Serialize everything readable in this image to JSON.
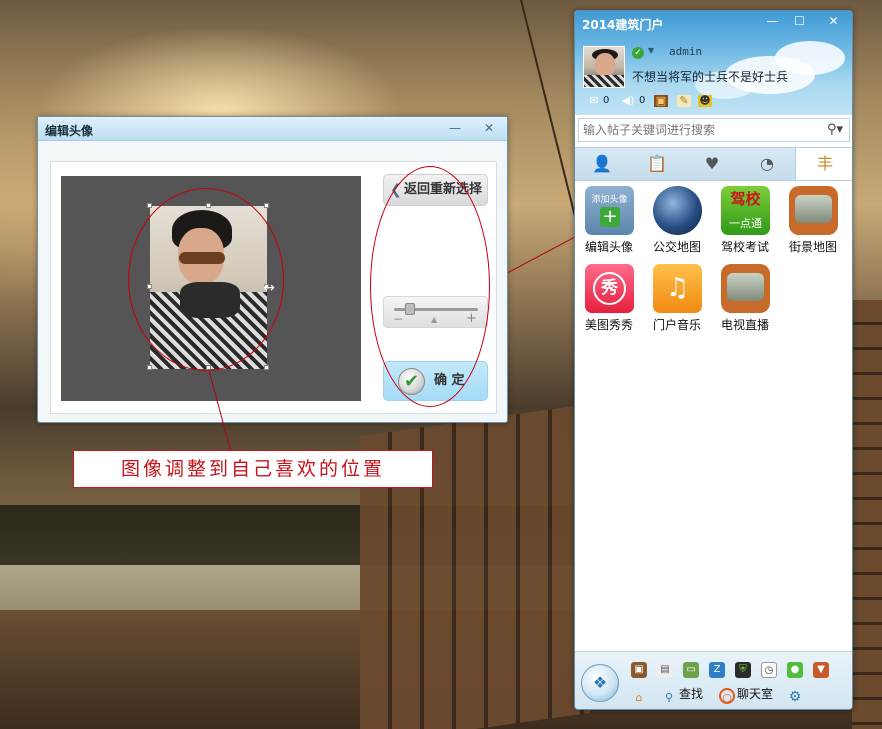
{
  "edit_window": {
    "title": "编辑头像",
    "minimize": "—",
    "close": "✕",
    "back_button": "返回重新选择",
    "confirm_button": "确 定",
    "zoom_slider": {
      "value": 0.15,
      "minus": "−",
      "plus": "+"
    }
  },
  "annotation": {
    "callout_text": "图像调整到自己喜欢的位置",
    "color": "#c4141c"
  },
  "portal": {
    "title": "2014建筑门户",
    "window_buttons": {
      "minimize": "—",
      "maximize": "☐",
      "close": "✕"
    },
    "user": {
      "name": "admin",
      "signature": "不想当将军的士兵不是好士兵",
      "status_icon": "online-check-icon"
    },
    "stats": [
      {
        "icon": "mail-icon",
        "value": "0"
      },
      {
        "icon": "speaker-icon",
        "value": "0"
      },
      {
        "icon": "photo-icon",
        "value": ""
      },
      {
        "icon": "note-icon",
        "value": ""
      },
      {
        "icon": "group-icon",
        "value": ""
      }
    ],
    "search": {
      "placeholder": "输入帖子关键词进行搜索",
      "value": ""
    },
    "tabs": [
      {
        "icon": "contacts-icon"
      },
      {
        "icon": "clipboard-icon"
      },
      {
        "icon": "heart-icon"
      },
      {
        "icon": "clock-icon"
      },
      {
        "icon": "signpost-icon",
        "active": true
      }
    ],
    "apps": [
      {
        "label": "编辑头像",
        "icon": "add-avatar-icon",
        "badge": "添加头像"
      },
      {
        "label": "公交地图",
        "icon": "globe-icon"
      },
      {
        "label": "驾校考试",
        "icon": "driving-school-icon",
        "badge": "驾校",
        "badge2": "一点通"
      },
      {
        "label": "街景地图",
        "icon": "tv-icon"
      },
      {
        "label": "美图秀秀",
        "icon": "meitu-icon",
        "badge": "秀"
      },
      {
        "label": "门户音乐",
        "icon": "music-icon"
      },
      {
        "label": "电视直播",
        "icon": "tv-icon"
      }
    ],
    "bottom": {
      "find_label": "查找",
      "chat_label": "聊天室"
    }
  },
  "colors": {
    "accent_blue": "#3f9ad4",
    "annotation_red": "#c4141c",
    "confirm_bg": "#a5dbf6"
  }
}
